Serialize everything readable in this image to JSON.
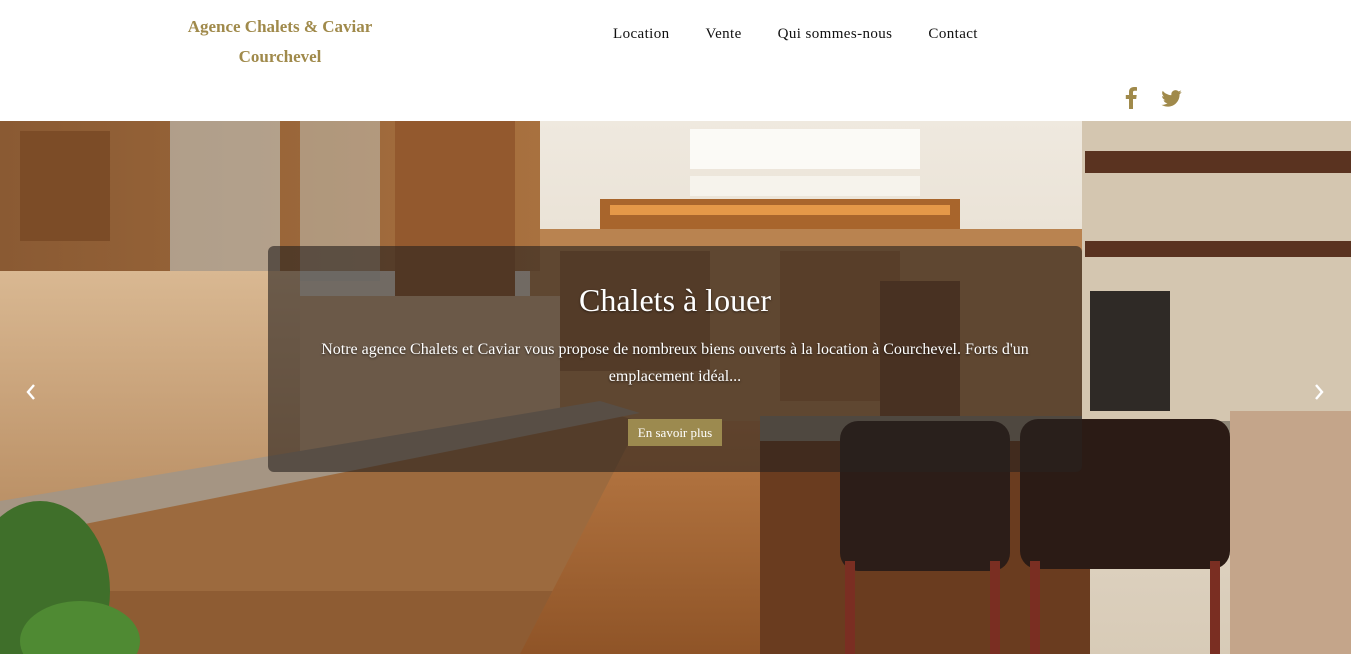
{
  "brand": {
    "line1": "Agence Chalets & Caviar",
    "line2": "Courchevel",
    "color": "#a08a4b"
  },
  "nav": {
    "items": [
      {
        "label": "Location"
      },
      {
        "label": "Vente"
      },
      {
        "label": "Qui sommes-nous"
      },
      {
        "label": "Contact"
      }
    ]
  },
  "social": {
    "icons": [
      "facebook-icon",
      "twitter-icon"
    ]
  },
  "slider": {
    "title": "Chalets à louer",
    "text": "Notre agence Chalets et Caviar vous propose de nombreux biens ouverts à la location à Courchevel. Forts d'un emplacement idéal...",
    "button_label": "En savoir plus",
    "button_color": "#9c8a4f",
    "prev_icon": "chevron-left-icon",
    "next_icon": "chevron-right-icon"
  }
}
